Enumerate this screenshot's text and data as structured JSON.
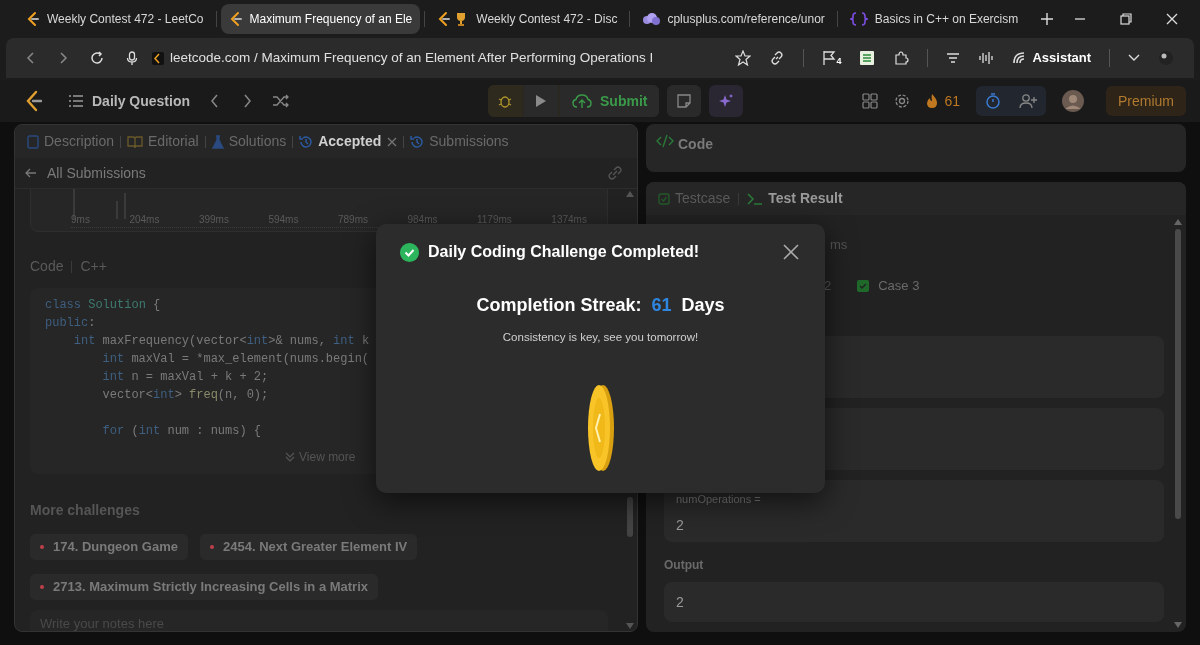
{
  "browser_tabs": [
    {
      "title": "Weekly Contest 472 - LeetCo",
      "selected": false
    },
    {
      "title": "Maximum Frequency of an Ele",
      "selected": true
    },
    {
      "title": "Weekly Contest 472 - Disc",
      "selected": false
    },
    {
      "title": "cplusplus.com/reference/unor",
      "selected": false
    },
    {
      "title": "Basics in C++ on Exercism",
      "selected": false
    }
  ],
  "address_bar": {
    "url": "leetcode.com / Maximum Frequency of an Element After Performing Operations I",
    "flag_count": "4",
    "assistant": "Assistant"
  },
  "header": {
    "title": "Daily Question",
    "submit": "Submit",
    "streak": "61",
    "premium": "Premium"
  },
  "left_panel": {
    "tabs": [
      {
        "label": "Description",
        "selected": false,
        "closable": false
      },
      {
        "label": "Editorial",
        "selected": false,
        "closable": false
      },
      {
        "label": "Solutions",
        "selected": false,
        "closable": false
      },
      {
        "label": "Accepted",
        "selected": true,
        "closable": true
      },
      {
        "label": "Submissions",
        "selected": false,
        "closable": false
      }
    ],
    "back_link": "All Submissions",
    "runtime_axis": [
      "9ms",
      "204ms",
      "399ms",
      "594ms",
      "789ms",
      "984ms",
      "1179ms",
      "1374ms"
    ],
    "code_label": "Code",
    "language": "C++",
    "code_paragraphs": [
      [
        {
          "tokens": [
            {
              "text": "class",
              "kind": "keyword"
            },
            {
              "text": " Solution",
              "kind": "type"
            },
            {
              "text": " {",
              "kind": "plain"
            }
          ]
        },
        {
          "tokens": [
            {
              "text": "public",
              "kind": "keyword"
            },
            {
              "text": ":",
              "kind": "plain"
            }
          ]
        },
        {
          "tokens": [
            {
              "text": "    int",
              "kind": "keyword"
            },
            {
              "text": " maxFrequency(vector<",
              "kind": "plain"
            },
            {
              "text": "int",
              "kind": "keyword"
            },
            {
              "text": ">& nums, ",
              "kind": "plain"
            },
            {
              "text": "int",
              "kind": "keyword"
            },
            {
              "text": " k",
              "kind": "plain"
            }
          ]
        },
        {
          "tokens": [
            {
              "text": "        int",
              "kind": "keyword"
            },
            {
              "text": " maxVal = *max_element(nums.begin(",
              "kind": "plain"
            }
          ]
        },
        {
          "tokens": [
            {
              "text": "        int",
              "kind": "keyword"
            },
            {
              "text": " n = maxVal + k + 2;",
              "kind": "plain"
            }
          ]
        },
        {
          "tokens": [
            {
              "text": "        vector<",
              "kind": "plain"
            },
            {
              "text": "int",
              "kind": "keyword"
            },
            {
              "text": "> ",
              "kind": "plain"
            },
            {
              "text": "freq",
              "kind": "func"
            },
            {
              "text": "(n, 0);",
              "kind": "plain"
            }
          ]
        }
      ],
      [
        {
          "tokens": [
            {
              "text": "        for",
              "kind": "keyword"
            },
            {
              "text": " (",
              "kind": "plain"
            },
            {
              "text": "int",
              "kind": "keyword"
            },
            {
              "text": " num : nums) {",
              "kind": "plain"
            }
          ]
        }
      ]
    ],
    "view_more": "View more",
    "more_challenges": {
      "title": "More challenges",
      "items": [
        {
          "label": "174. Dungeon Game",
          "color": "#c0404a"
        },
        {
          "label": "2454. Next Greater Element IV",
          "color": "#c0404a"
        },
        {
          "label": "2713. Maximum Strictly Increasing Cells in a Matrix",
          "color": "#c0404a"
        }
      ]
    },
    "notes": {
      "placeholder": "Write your notes here"
    }
  },
  "code_panel": {
    "title": "Code"
  },
  "result_panel": {
    "tabs": [
      {
        "label": "Testcase",
        "selected": false
      },
      {
        "label": "Test Result",
        "selected": true
      }
    ],
    "runtime_fragment": "ms",
    "case_fragment": "2",
    "cases": [
      {
        "label": "Case 3",
        "passed": true
      }
    ],
    "inputs": [
      {
        "label": "numOperations =",
        "value": "2"
      }
    ],
    "output": {
      "label": "Output",
      "value": "2"
    }
  },
  "modal": {
    "title": "Daily Coding Challenge Completed!",
    "streak_label": "Completion Streak:",
    "streak_value": "61",
    "streak_unit": "Days",
    "message": "Consistency is key, see you tomorrow!"
  }
}
